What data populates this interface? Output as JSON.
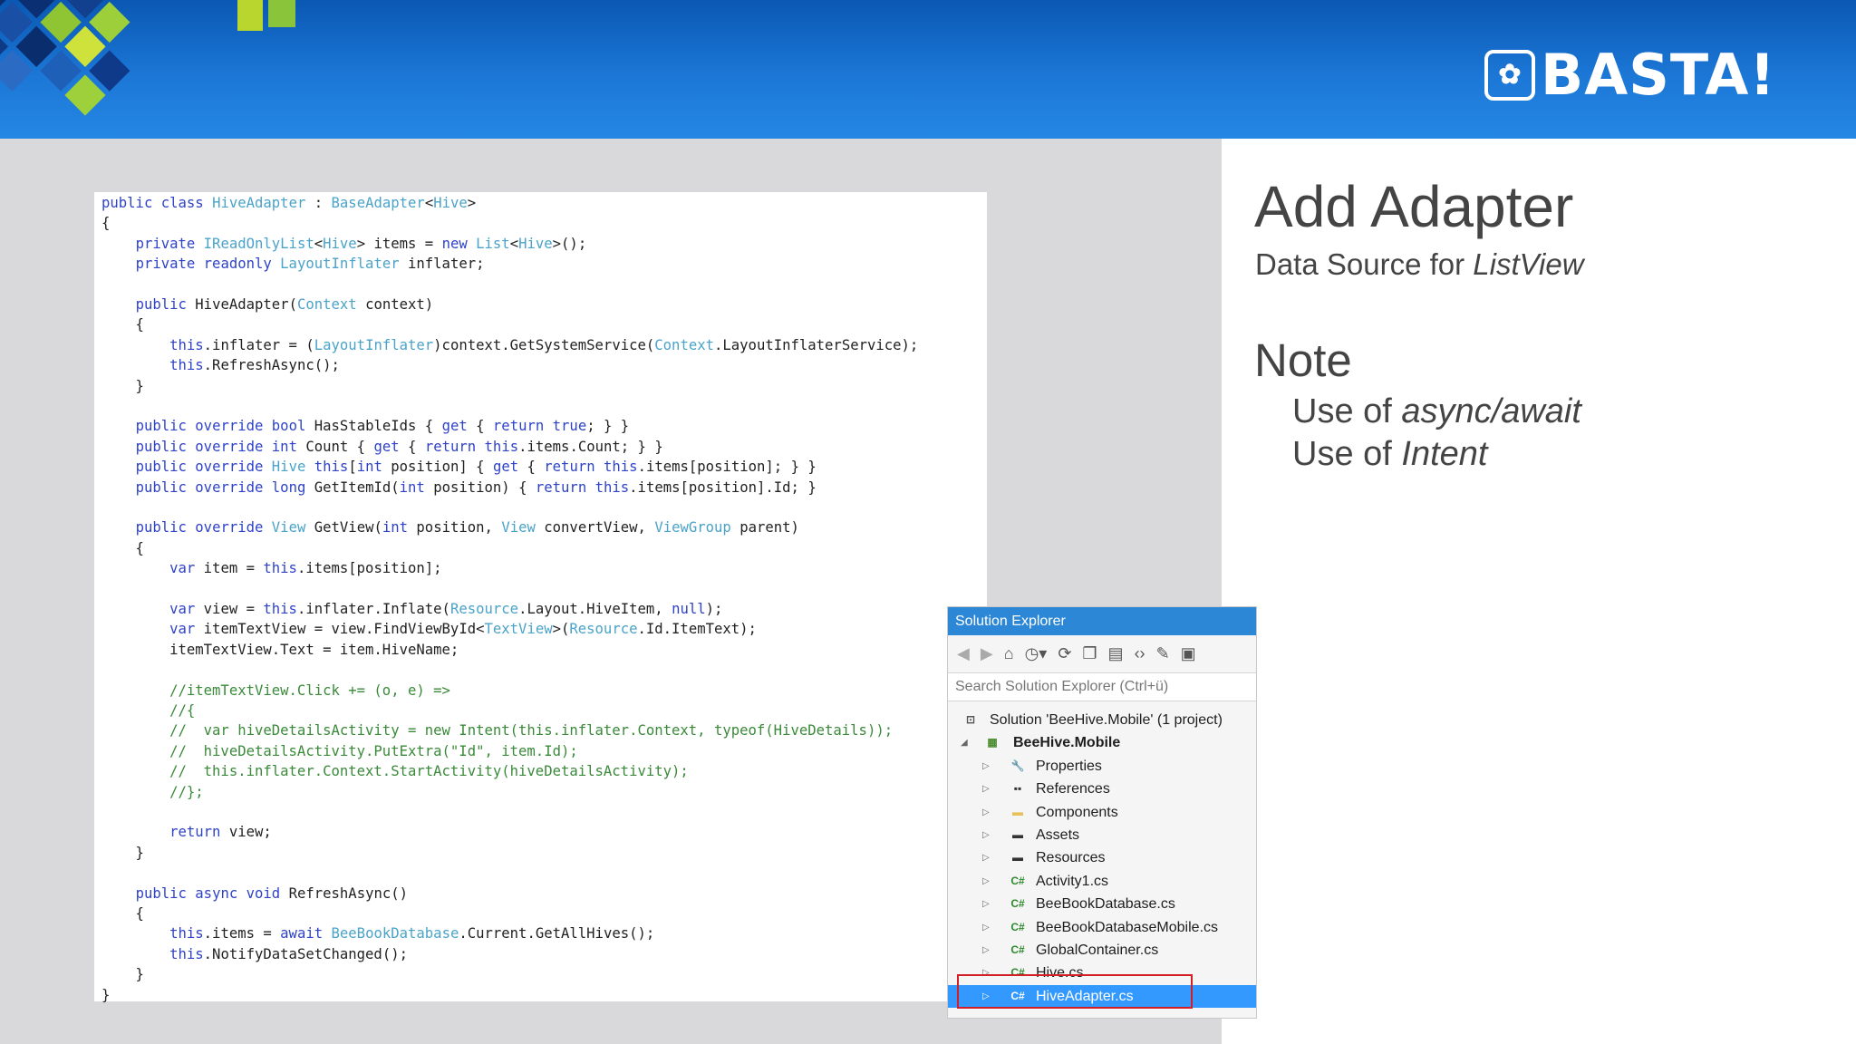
{
  "header": {
    "logo_text": "BASTA!",
    "logo_glyph": "✿"
  },
  "slide": {
    "title": "Add Adapter",
    "subtitle_plain": "Data Source for ",
    "subtitle_italic": "ListView",
    "note_title": "Note",
    "note_items": [
      {
        "plain": "Use of ",
        "italic": "async/await"
      },
      {
        "plain": "Use of ",
        "italic": "Intent"
      }
    ]
  },
  "code_lines": [
    "public class HiveAdapter : BaseAdapter<Hive>",
    "{",
    "    private IReadOnlyList<Hive> items = new List<Hive>();",
    "    private readonly LayoutInflater inflater;",
    "",
    "    public HiveAdapter(Context context)",
    "    {",
    "        this.inflater = (LayoutInflater)context.GetSystemService(Context.LayoutInflaterService);",
    "        this.RefreshAsync();",
    "    }",
    "",
    "    public override bool HasStableIds { get { return true; } }",
    "    public override int Count { get { return this.items.Count; } }",
    "    public override Hive this[int position] { get { return this.items[position]; } }",
    "    public override long GetItemId(int position) { return this.items[position].Id; }",
    "",
    "    public override View GetView(int position, View convertView, ViewGroup parent)",
    "    {",
    "        var item = this.items[position];",
    "",
    "        var view = this.inflater.Inflate(Resource.Layout.HiveItem, null);",
    "        var itemTextView = view.FindViewById<TextView>(Resource.Id.ItemText);",
    "        itemTextView.Text = item.HiveName;",
    "",
    "        //itemTextView.Click += (o, e) =>",
    "        //{",
    "        //  var hiveDetailsActivity = new Intent(this.inflater.Context, typeof(HiveDetails));",
    "        //  hiveDetailsActivity.PutExtra(\"Id\", item.Id);",
    "        //  this.inflater.Context.StartActivity(hiveDetailsActivity);",
    "        //};",
    "",
    "        return view;",
    "    }",
    "",
    "    public async void RefreshAsync()",
    "    {",
    "        this.items = await BeeBookDatabase.Current.GetAllHives();",
    "        this.NotifyDataSetChanged();",
    "    }",
    "}"
  ],
  "solution_explorer": {
    "title": "Solution Explorer",
    "search_placeholder": "Search Solution Explorer (Ctrl+ü)",
    "toolbar_icons": [
      "back-icon",
      "forward-icon",
      "home-icon",
      "history-icon",
      "refresh-icon",
      "collapse-all-icon",
      "copy-icon",
      "code-view-icon",
      "properties-wrench-icon",
      "preview-icon"
    ],
    "items": [
      {
        "label": "Solution 'BeeHive.Mobile' (1 project)",
        "icon": "solution-icon",
        "level": 0,
        "arrow": ""
      },
      {
        "label": "BeeHive.Mobile",
        "icon": "project-icon",
        "level": 0,
        "arrow": "◢",
        "bold": true
      },
      {
        "label": "Properties",
        "icon": "wrench-icon",
        "level": 1,
        "arrow": "▷"
      },
      {
        "label": "References",
        "icon": "references-icon",
        "level": 1,
        "arrow": "▷"
      },
      {
        "label": "Components",
        "icon": "folder-icon",
        "level": 1,
        "arrow": "▷"
      },
      {
        "label": "Assets",
        "icon": "special-folder-icon",
        "level": 1,
        "arrow": "▷"
      },
      {
        "label": "Resources",
        "icon": "special-folder-icon",
        "level": 1,
        "arrow": "▷"
      },
      {
        "label": "Activity1.cs",
        "icon": "csharp-file-icon",
        "level": 1,
        "arrow": "▷"
      },
      {
        "label": "BeeBookDatabase.cs",
        "icon": "csharp-file-icon",
        "level": 1,
        "arrow": "▷"
      },
      {
        "label": "BeeBookDatabaseMobile.cs",
        "icon": "csharp-file-icon",
        "level": 1,
        "arrow": "▷"
      },
      {
        "label": "GlobalContainer.cs",
        "icon": "csharp-file-icon",
        "level": 1,
        "arrow": "▷"
      },
      {
        "label": "Hive.cs",
        "icon": "csharp-file-icon",
        "level": 1,
        "arrow": "▷"
      },
      {
        "label": "HiveAdapter.cs",
        "icon": "csharp-file-icon",
        "level": 1,
        "arrow": "▷",
        "selected": true
      }
    ]
  },
  "colors": {
    "header_blue": "#1c77d6",
    "selection": "#3399ff",
    "highlight_box": "#d21f26"
  }
}
